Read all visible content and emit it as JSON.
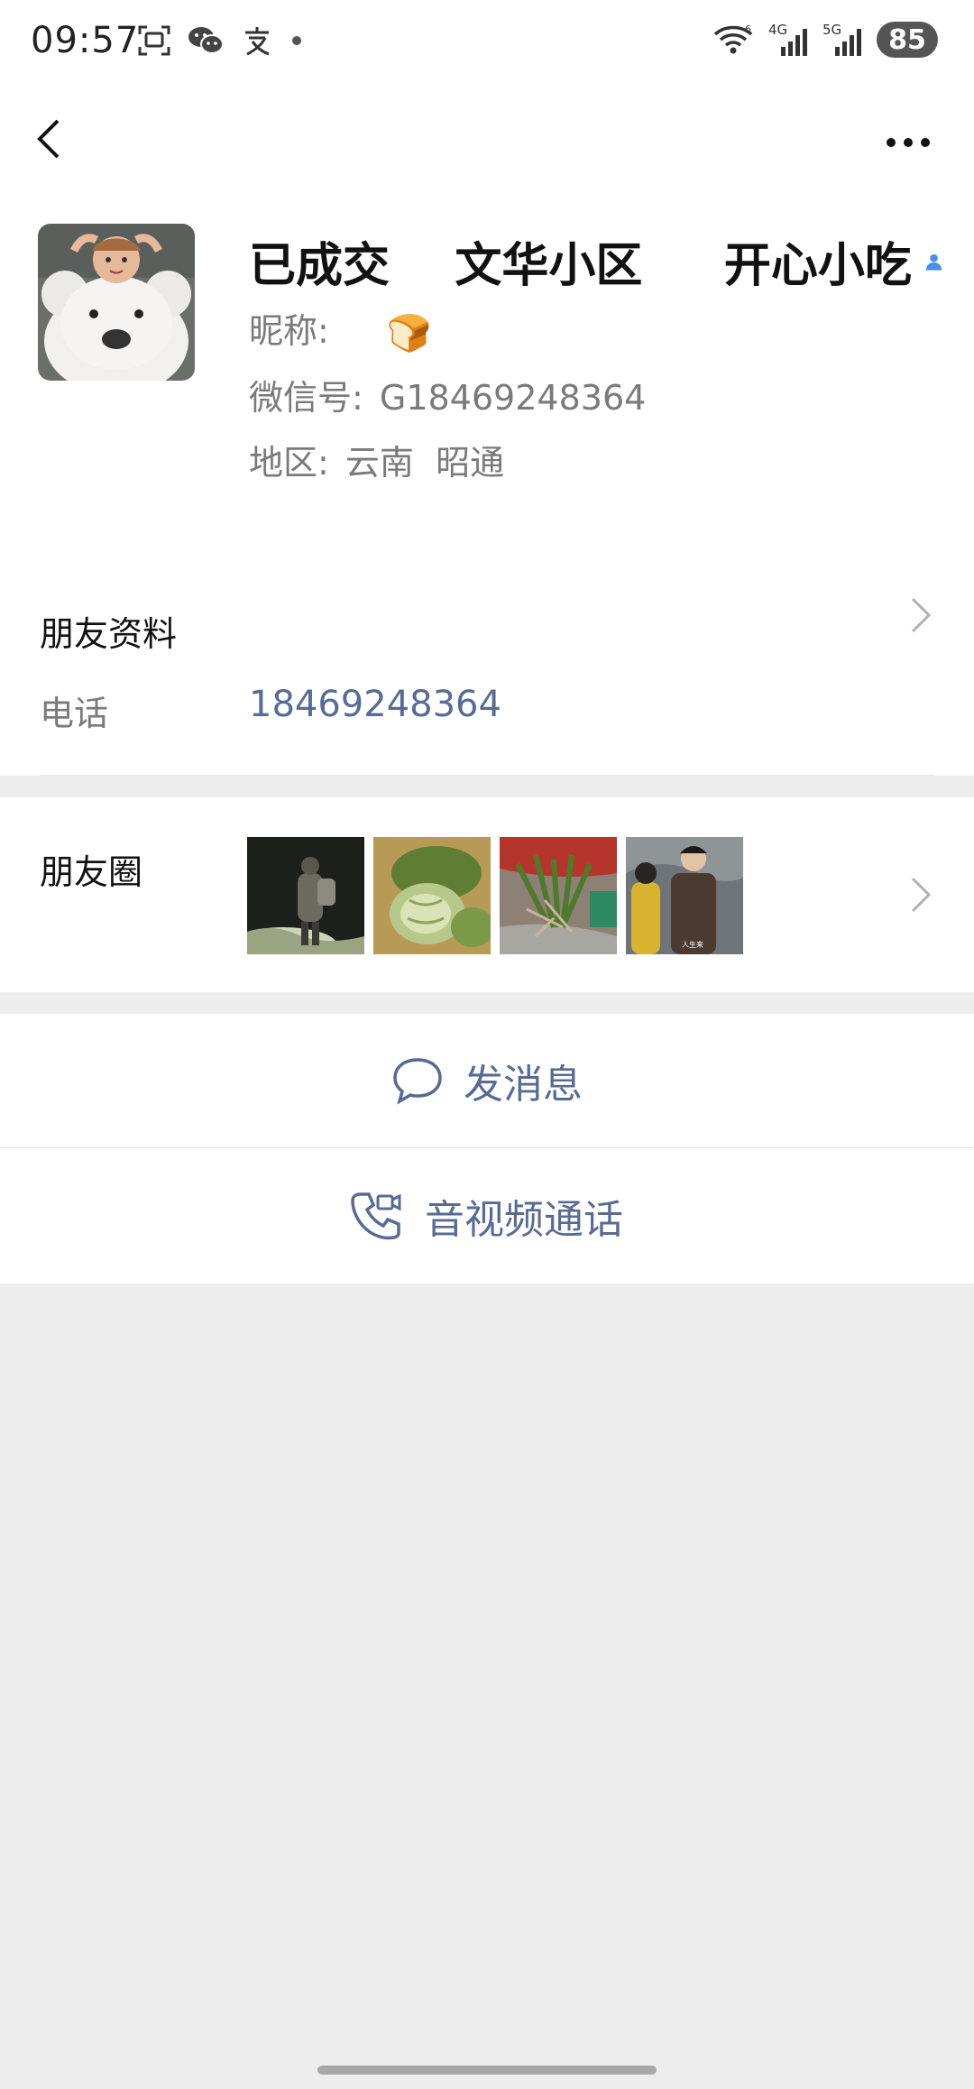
{
  "status": {
    "time": "09:57",
    "battery": "85",
    "net1": "4G",
    "net2": "5G"
  },
  "profile": {
    "name": "已成交    文华小区     开心小吃",
    "nickname_label": "昵称:",
    "nickname_emoji": "🍞",
    "wechat_label": "微信号:",
    "wechat_id": "G18469248364",
    "region_label": "地区:",
    "region_value": "云南  昭通"
  },
  "friend_info": {
    "title": "朋友资料",
    "phone_label": "电话",
    "phone_value": "18469248364"
  },
  "moments": {
    "title": "朋友圈",
    "thumb4_caption": "人生来"
  },
  "actions": {
    "message": "发消息",
    "call": "音视频通话"
  },
  "colors": {
    "link": "#576b95",
    "background": "#ededed",
    "contact_icon": "#4a90e2"
  }
}
